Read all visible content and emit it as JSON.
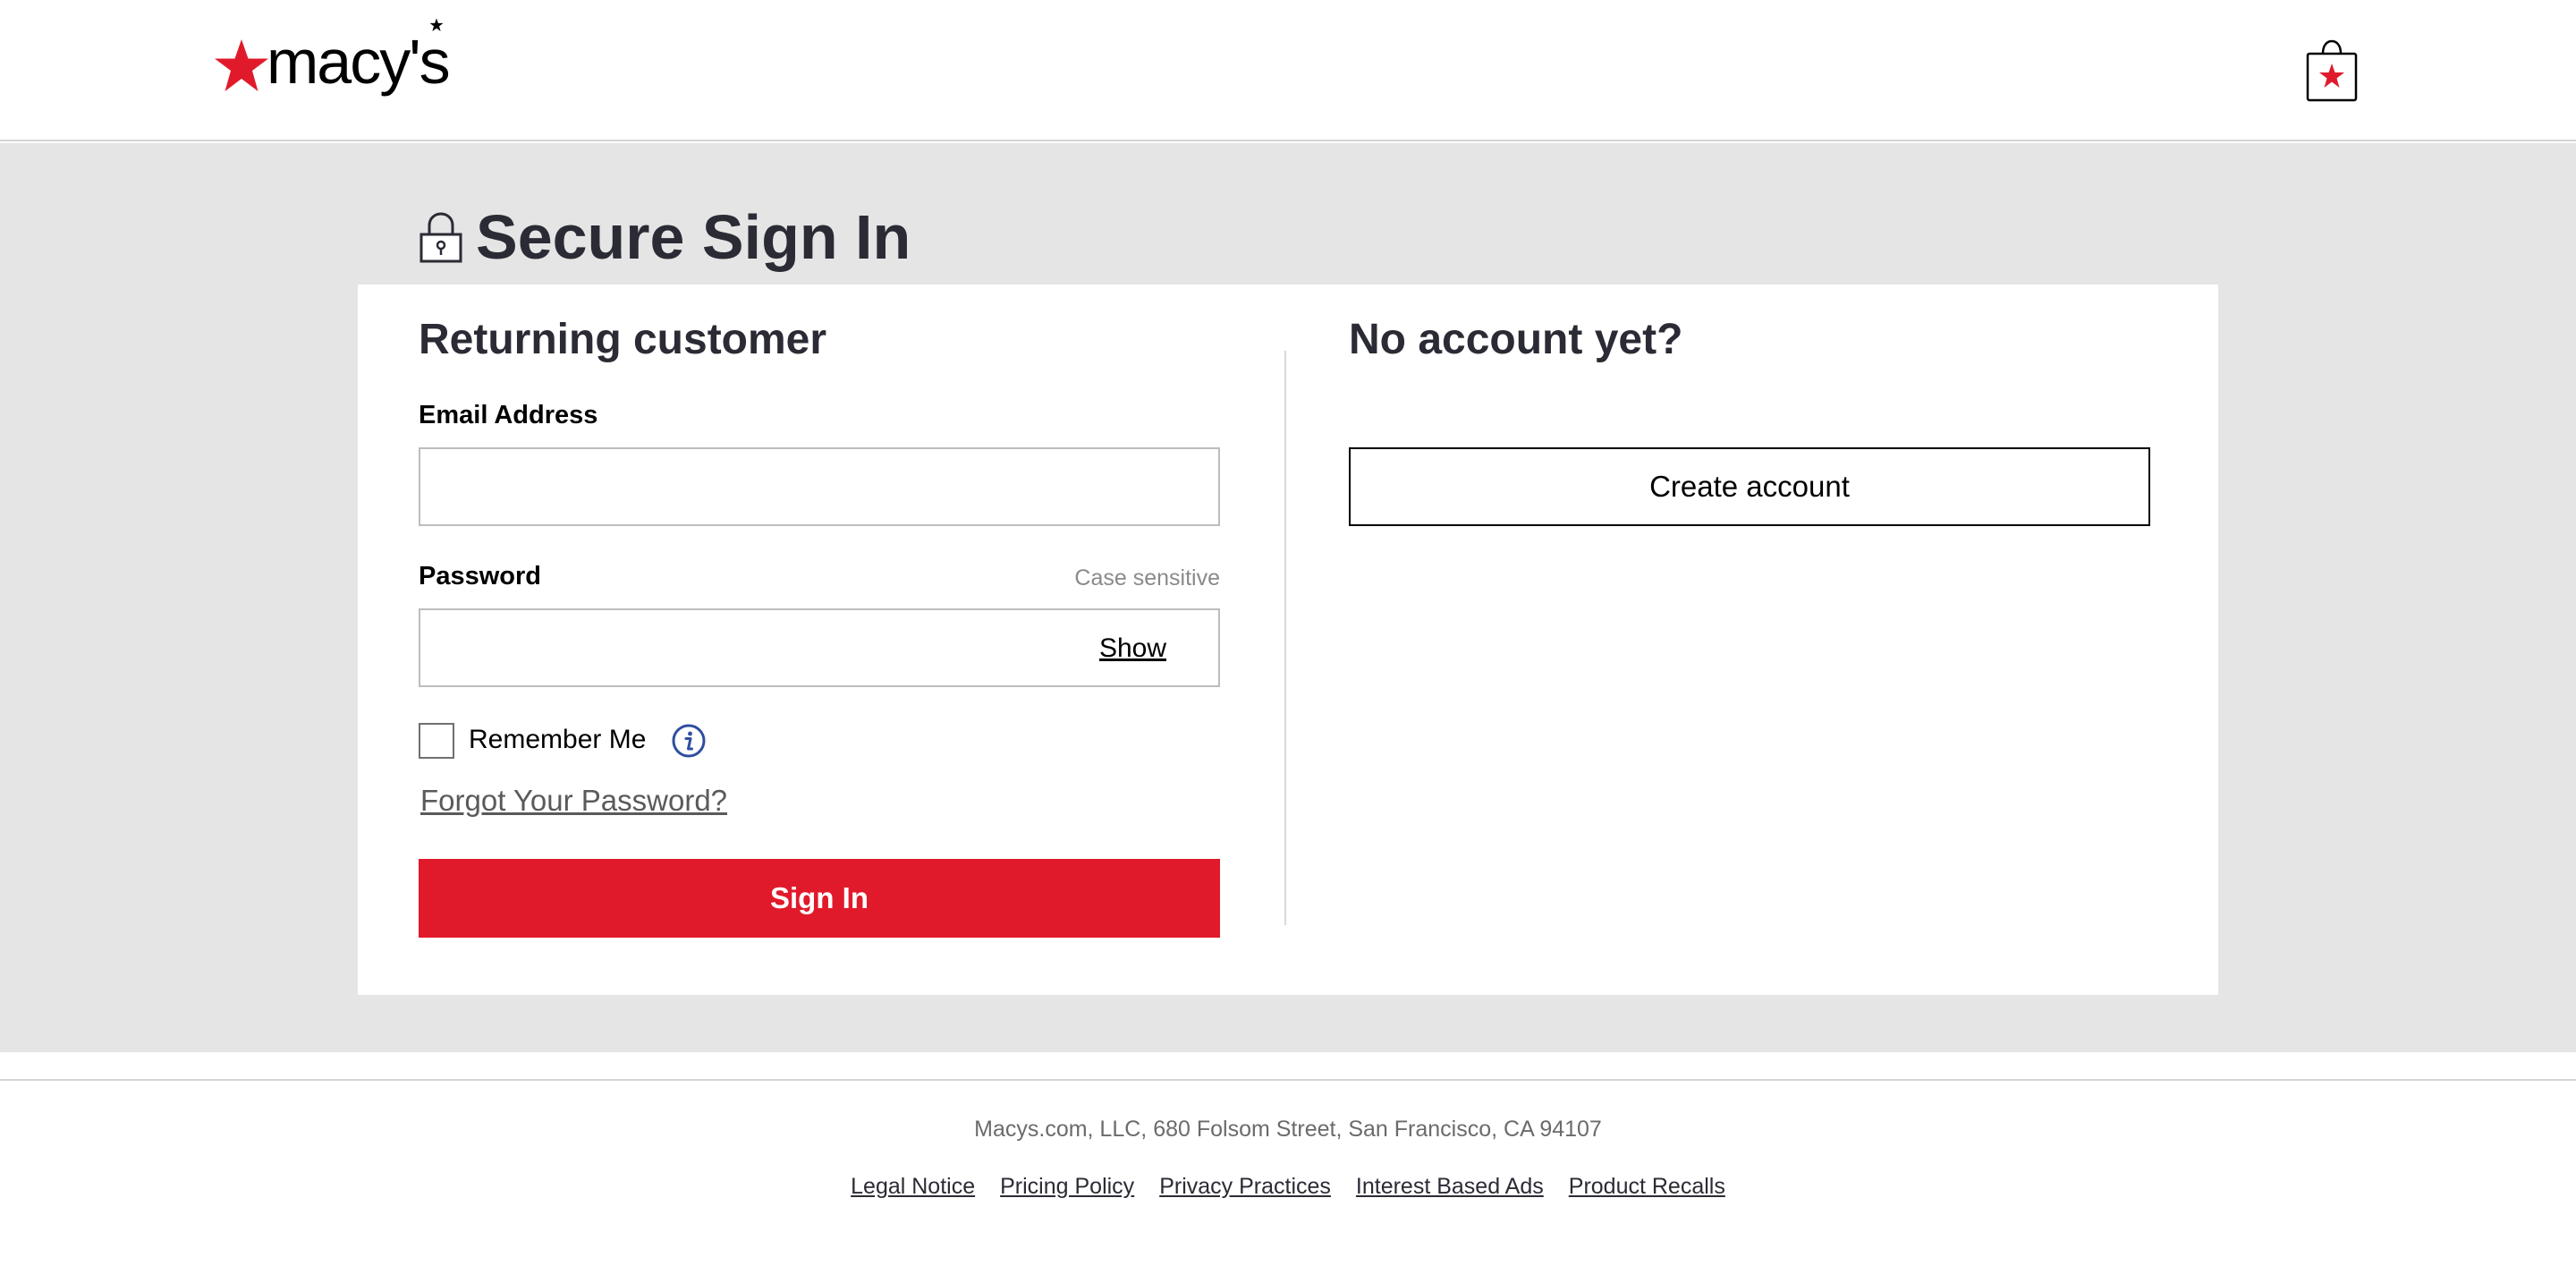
{
  "header": {
    "logo_text": "macy's",
    "logo_icon": "macys-star-icon",
    "bag_icon": "shopping-bag-icon"
  },
  "page": {
    "title": "Secure Sign In",
    "title_icon": "lock-icon"
  },
  "returning": {
    "heading": "Returning customer",
    "email_label": "Email Address",
    "email_value": "",
    "password_label": "Password",
    "password_hint": "Case sensitive",
    "password_value": "",
    "show_label": "Show",
    "remember_label": "Remember Me",
    "remember_checked": false,
    "info_icon": "info-icon",
    "forgot_label": "Forgot Your Password?",
    "signin_label": "Sign In"
  },
  "new_customer": {
    "heading": "No account yet?",
    "create_label": "Create account"
  },
  "footer": {
    "address": "Macys.com, LLC, 680 Folsom Street, San Francisco, CA 94107",
    "links": [
      "Legal Notice",
      "Pricing Policy",
      "Privacy Practices",
      "Interest Based Ads",
      "Product Recalls"
    ]
  },
  "colors": {
    "brand_red": "#e11a2b",
    "background_gray": "#e5e5e5",
    "text_dark": "#2b2b35",
    "info_blue": "#2f4ea0"
  }
}
